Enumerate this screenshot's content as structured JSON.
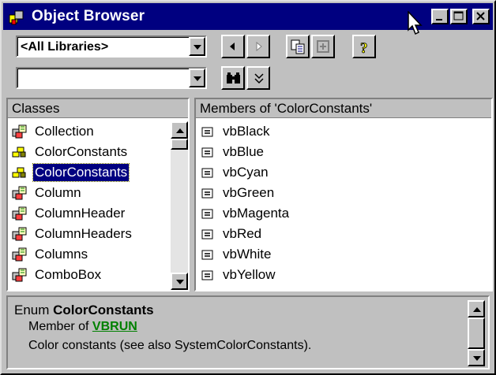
{
  "window": {
    "title": "Object Browser"
  },
  "toolbar": {
    "library_combo_value": "<All Libraries>",
    "search_combo_value": ""
  },
  "classes": {
    "header": "Classes",
    "items": [
      {
        "label": "Collection",
        "icon": "class-icon",
        "selected": false
      },
      {
        "label": "ColorConstants",
        "icon": "enum-icon",
        "selected": false
      },
      {
        "label": "ColorConstants",
        "icon": "enum-icon",
        "selected": true
      },
      {
        "label": "Column",
        "icon": "class-icon",
        "selected": false
      },
      {
        "label": "ColumnHeader",
        "icon": "class-icon",
        "selected": false
      },
      {
        "label": "ColumnHeaders",
        "icon": "class-icon",
        "selected": false
      },
      {
        "label": "Columns",
        "icon": "class-icon",
        "selected": false
      },
      {
        "label": "ComboBox",
        "icon": "class-icon",
        "selected": false
      }
    ]
  },
  "members": {
    "header": "Members of 'ColorConstants'",
    "items": [
      {
        "label": "vbBlack",
        "icon": "constant-icon"
      },
      {
        "label": "vbBlue",
        "icon": "constant-icon"
      },
      {
        "label": "vbCyan",
        "icon": "constant-icon"
      },
      {
        "label": "vbGreen",
        "icon": "constant-icon"
      },
      {
        "label": "vbMagenta",
        "icon": "constant-icon"
      },
      {
        "label": "vbRed",
        "icon": "constant-icon"
      },
      {
        "label": "vbWhite",
        "icon": "constant-icon"
      },
      {
        "label": "vbYellow",
        "icon": "constant-icon"
      }
    ]
  },
  "details": {
    "prefix": "Enum ",
    "name": "ColorConstants",
    "member_of_prefix": "Member of ",
    "member_of_link": "VBRUN",
    "description": "Color constants (see also SystemColorConstants)."
  },
  "colors": {
    "title_bar": "#000080",
    "selection": "#000080",
    "link": "#008000",
    "face": "#c0c0c0"
  }
}
